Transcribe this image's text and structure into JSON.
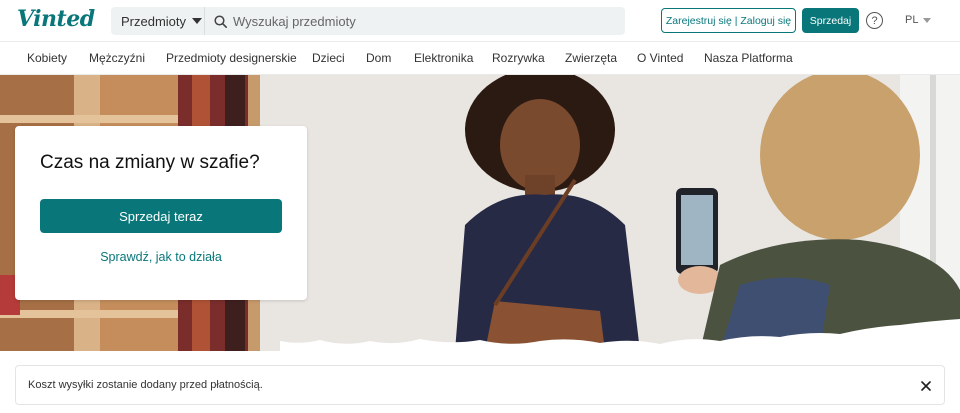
{
  "header": {
    "logo": "Vinted",
    "category_label": "Przedmioty",
    "search_placeholder": "Wyszukaj przedmioty",
    "auth_label": "Zarejestruj się | Zaloguj się",
    "sell_label": "Sprzedaj",
    "help_glyph": "?",
    "language": "PL"
  },
  "nav": {
    "items": [
      "Kobiety",
      "Mężczyźni",
      "Przedmioty designerskie",
      "Dzieci",
      "Dom",
      "Elektronika",
      "Rozrywka",
      "Zwierzęta",
      "O Vinted",
      "Nasza Platforma"
    ]
  },
  "hero": {
    "title": "Czas na zmiany w szafie?",
    "cta_label": "Sprzedaj teraz",
    "link_label": "Sprawdź, jak to działa"
  },
  "notice": {
    "text": "Koszt wysyłki zostanie dodany przed płatnością."
  },
  "colors": {
    "brand": "#09777a",
    "search_bg": "#eef2f2"
  },
  "icons": {
    "search": "search-icon",
    "help": "help-icon",
    "close": "close-icon",
    "caret": "chevron-down-icon"
  }
}
